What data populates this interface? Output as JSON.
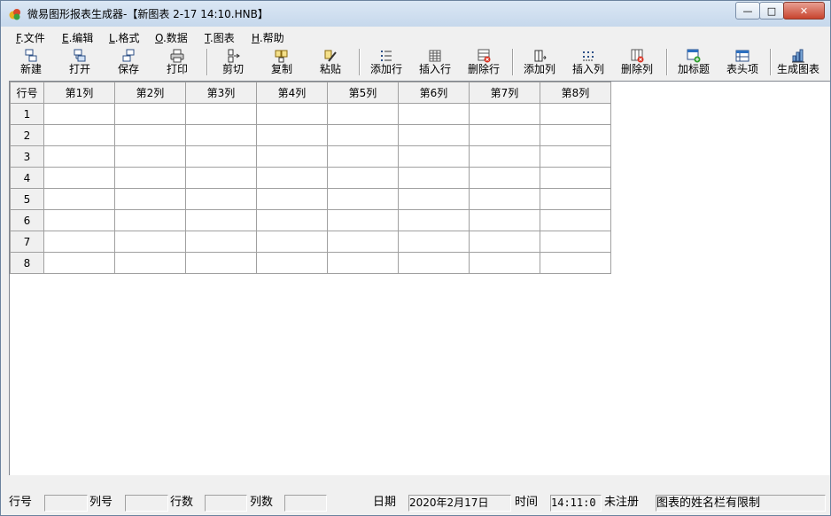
{
  "window": {
    "title": "微易图形报表生成器-【新图表 2-17 14:10.HNB】",
    "controls": {
      "minimize": "—",
      "maximize": "□",
      "close": "✕"
    }
  },
  "menu": [
    {
      "accel": "F",
      "label": ".文件"
    },
    {
      "accel": "E",
      "label": ".编辑"
    },
    {
      "accel": "L",
      "label": ".格式"
    },
    {
      "accel": "O",
      "label": ".数据"
    },
    {
      "accel": "T",
      "label": ".图表"
    },
    {
      "accel": "H",
      "label": ".帮助"
    }
  ],
  "toolbar": [
    {
      "label": "新建",
      "icon": "new-doc-icon"
    },
    {
      "label": "打开",
      "icon": "open-icon"
    },
    {
      "label": "保存",
      "icon": "save-icon"
    },
    {
      "label": "打印",
      "icon": "print-icon"
    },
    {
      "label": "剪切",
      "icon": "cut-icon"
    },
    {
      "label": "复制",
      "icon": "copy-icon"
    },
    {
      "label": "粘贴",
      "icon": "paste-icon"
    },
    {
      "label": "添加行",
      "icon": "add-row-icon"
    },
    {
      "label": "插入行",
      "icon": "insert-row-icon"
    },
    {
      "label": "删除行",
      "icon": "delete-row-icon"
    },
    {
      "label": "添加列",
      "icon": "add-column-icon"
    },
    {
      "label": "插入列",
      "icon": "insert-column-icon"
    },
    {
      "label": "删除列",
      "icon": "delete-column-icon"
    },
    {
      "label": "加标题",
      "icon": "add-title-icon"
    },
    {
      "label": "表头项",
      "icon": "header-item-icon"
    },
    {
      "label": "生成图表",
      "icon": "generate-chart-icon"
    }
  ],
  "grid": {
    "corner": "行号",
    "columns": [
      "第1列",
      "第2列",
      "第3列",
      "第4列",
      "第5列",
      "第6列",
      "第7列",
      "第8列"
    ],
    "rows": [
      "1",
      "2",
      "3",
      "4",
      "5",
      "6",
      "7",
      "8"
    ]
  },
  "status": {
    "row_label": "行号",
    "row_value": "",
    "col_label": "列号",
    "col_value": "",
    "rowcount_label": "行数",
    "rowcount_value": "",
    "colcount_label": "列数",
    "colcount_value": "",
    "date_label": "日期",
    "date_value": "2020年2月17日",
    "time_label": "时间",
    "time_value": "14:11:0",
    "registration": "未注册",
    "notice": "图表的姓名栏有限制"
  }
}
